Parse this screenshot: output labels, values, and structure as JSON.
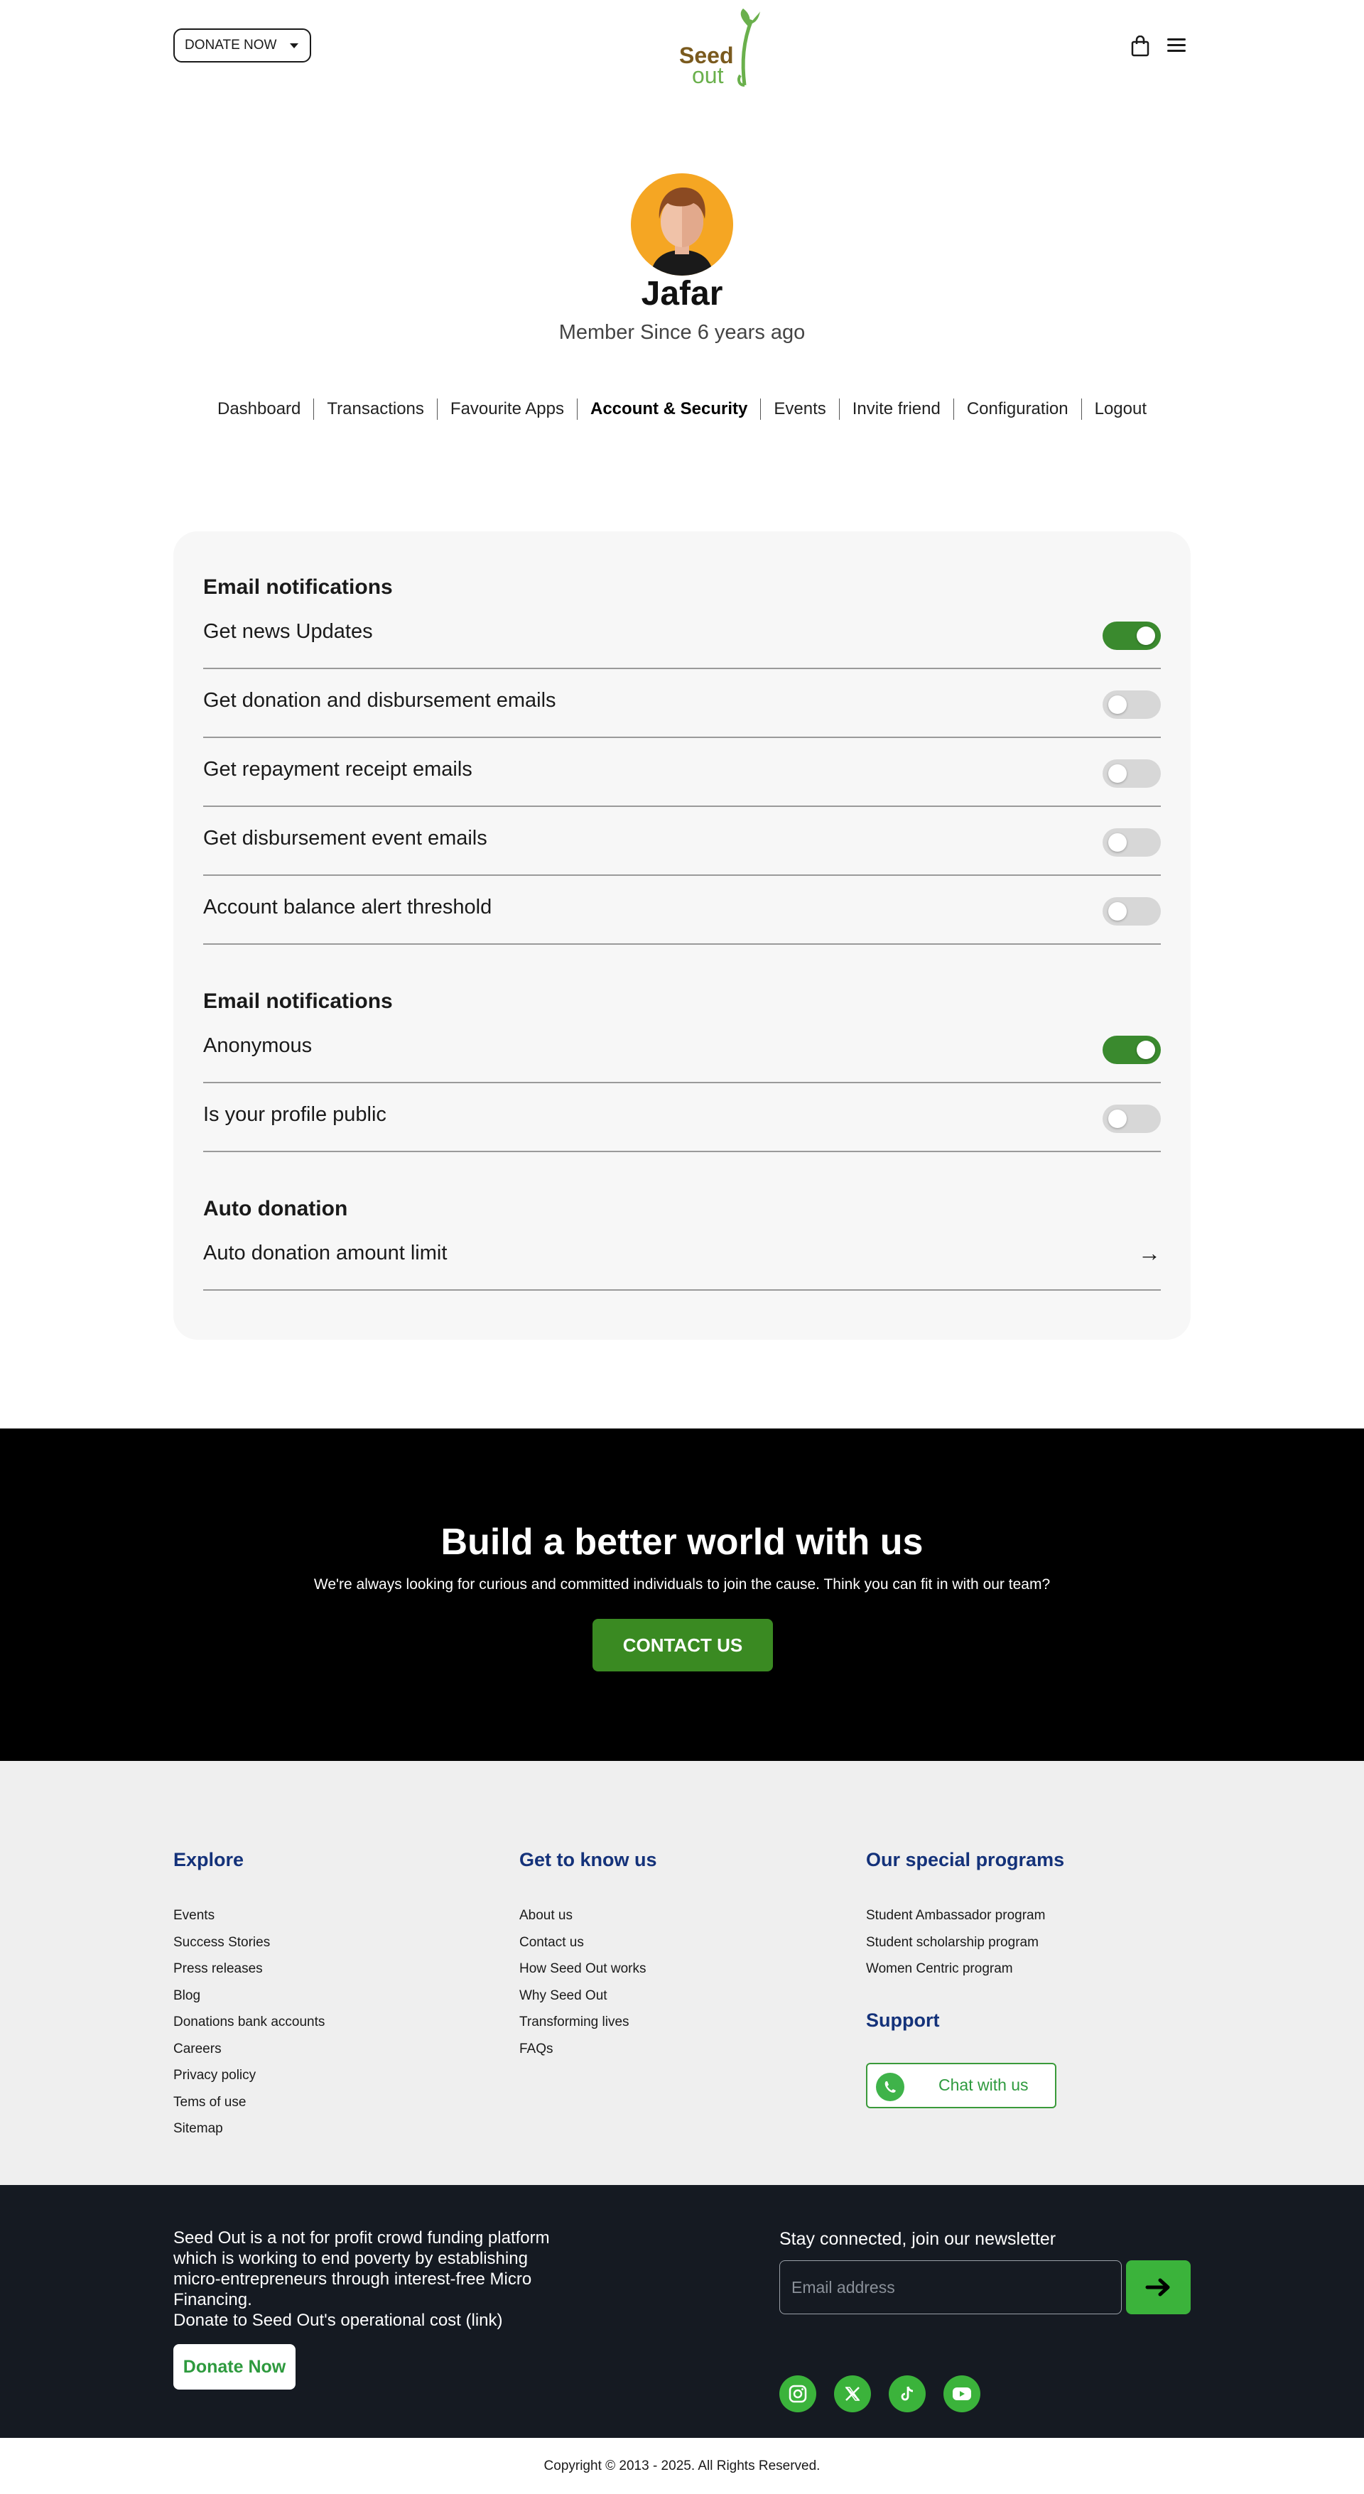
{
  "header": {
    "donate_label": "DONATE NOW",
    "logo_seed": "Seed",
    "logo_out": "out"
  },
  "profile": {
    "name": "Jafar",
    "member_since": "Member Since 6 years ago"
  },
  "nav": [
    "Dashboard",
    "Transactions",
    "Favourite Apps",
    "Account & Security",
    "Events",
    "Invite friend",
    "Configuration",
    "Logout"
  ],
  "nav_active": "Account & Security",
  "settings": {
    "section1_title": "Email notifications",
    "section1_rows": [
      {
        "label": "Get news Updates",
        "on": true
      },
      {
        "label": "Get donation and disbursement emails",
        "on": false
      },
      {
        "label": "Get repayment receipt emails",
        "on": false
      },
      {
        "label": "Get disbursement event emails",
        "on": false
      },
      {
        "label": "Account balance alert threshold",
        "on": false
      }
    ],
    "section2_title": "Email notifications",
    "section2_rows": [
      {
        "label": "Anonymous",
        "on": true
      },
      {
        "label": "Is your profile public",
        "on": false
      }
    ],
    "section3_title": "Auto donation",
    "auto_donation_row": "Auto donation amount limit"
  },
  "cta": {
    "title": "Build a better world with us",
    "text": "We're always looking for curious and committed individuals to join the cause. Think you can fit in with our team?",
    "button": "CONTACT US"
  },
  "footer": {
    "explore_title": "Explore",
    "explore_links": [
      "Events",
      "Success Stories",
      "Press releases",
      "Blog",
      "Donations bank accounts",
      "Careers",
      "Privacy policy",
      "Tems of use",
      "Sitemap"
    ],
    "know_title": "Get to know us",
    "know_links": [
      "About us",
      "Contact us",
      "How Seed Out works",
      "Why Seed Out",
      "Transforming lives",
      "FAQs"
    ],
    "programs_title": "Our special programs",
    "programs_links": [
      "Student Ambassador program",
      "Student scholarship program",
      "Women Centric program"
    ],
    "support_title": "Support",
    "chat_label": "Chat with us"
  },
  "footer_dark": {
    "about_lines": [
      "Seed Out is a not for profit crowd funding platform",
      "which is working to end poverty by establishing",
      "micro-entrepreneurs through interest-free Micro",
      "Financing.",
      "Donate to Seed Out's operational cost (link)"
    ],
    "donate_label": "Donate Now",
    "newsletter_title": "Stay connected, join our newsletter",
    "email_placeholder": "Email address"
  },
  "copyright": "Copyright © 2013 - 2025. All Rights Reserved.",
  "colors": {
    "brand_green": "#3a8a2e",
    "link_blue": "#14327a",
    "footer_dark": "#151a22"
  }
}
